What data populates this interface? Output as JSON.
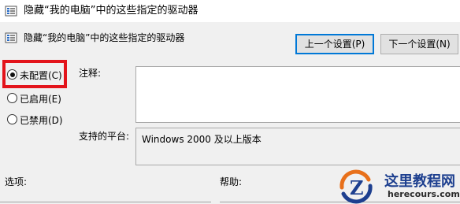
{
  "window": {
    "title": "隐藏“我的电脑”中的这些指定的驱动器",
    "icon": "policy-settings-icon"
  },
  "header": {
    "setting_name": "隐藏“我的电脑”中的这些指定的驱动器",
    "icon": "policy-settings-icon"
  },
  "nav_buttons": {
    "prev_label": "上一个设置(P)",
    "next_label": "下一个设置(N)"
  },
  "state_options": [
    {
      "label": "未配置(C)",
      "checked": true
    },
    {
      "label": "已启用(E)",
      "checked": false
    },
    {
      "label": "已禁用(D)",
      "checked": false
    }
  ],
  "highlight_color": "#e3141b",
  "notes": {
    "label": "注释:",
    "value": ""
  },
  "platform": {
    "label": "支持的平台:",
    "value": "Windows 2000 及以上版本"
  },
  "bottom": {
    "options_label": "选项:",
    "help_label": "帮助:"
  },
  "watermark": {
    "cn_text": "这里教程网",
    "en_text": "herecours.com"
  }
}
